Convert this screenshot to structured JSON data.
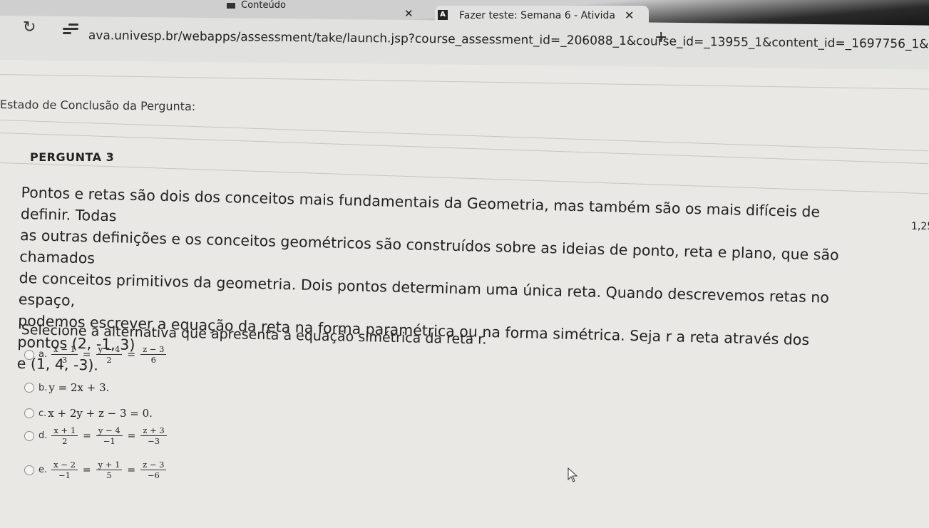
{
  "browser": {
    "prev_tab_title": "Conteúdo",
    "active_tab_title": "Fazer teste: Semana 6 - Ativida",
    "url": "ava.univesp.br/webapps/assessment/take/launch.jsp?course_assessment_id=_206088_1&course_id=_13955_1&content_id=_1697756_1&step=null"
  },
  "question": {
    "status_label": "Estado de Conclusão da Pergunta:",
    "title": "PERGUNTA 3",
    "points": "1,25",
    "prompt_lines": [
      "Pontos e retas são dois dos conceitos mais fundamentais da Geometria, mas também são os mais difíceis de definir. Todas",
      "as outras definições e os conceitos geométricos são construídos sobre as ideias de ponto, reta e plano, que são chamados",
      "de conceitos primitivos da geometria. Dois pontos determinam uma única reta. Quando descrevemos retas no espaço,",
      "podemos escrever a equação da reta na forma paramétrica ou na forma simétrica. Seja r a reta através dos pontos (2, -1, 3)",
      "e (1, 4, -3)."
    ],
    "instruction": "Selecione a alternativa que apresenta a equação simétrica da reta r."
  },
  "options": [
    {
      "letter": "a.",
      "kind": "frac",
      "terms": [
        [
          "x − 1",
          "3"
        ],
        [
          "y − 4",
          "2"
        ],
        [
          "z − 3",
          "6"
        ]
      ]
    },
    {
      "letter": "b.",
      "kind": "text",
      "text": "y = 2x + 3."
    },
    {
      "letter": "c.",
      "kind": "text",
      "text": "x + 2y + z − 3 = 0."
    },
    {
      "letter": "d.",
      "kind": "frac",
      "terms": [
        [
          "x + 1",
          "2"
        ],
        [
          "y − 4",
          "−1"
        ],
        [
          "z + 3",
          "−3"
        ]
      ]
    },
    {
      "letter": "e.",
      "kind": "frac",
      "terms": [
        [
          "x − 2",
          "−1"
        ],
        [
          "y + 1",
          "5"
        ],
        [
          "z − 3",
          "−6"
        ]
      ]
    }
  ]
}
